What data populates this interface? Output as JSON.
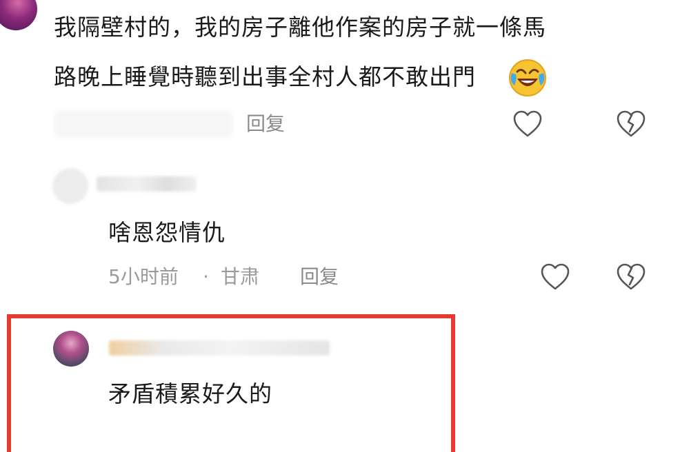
{
  "comments": [
    {
      "text_line1": "我隔壁村的，我的房子離他作案的房子就一條馬",
      "text_line2": "路晚上睡覺時聽到出事全村人都不敢出門",
      "reply_label": "回复",
      "emoji_name": "laughing-crying-face"
    },
    {
      "text": "啥恩怨情仇",
      "time": "5小时前",
      "separator": "·",
      "location": "甘肃",
      "reply_label": "回复"
    },
    {
      "text": "矛盾積累好久的"
    }
  ],
  "colors": {
    "highlight_border": "#e53a2d",
    "meta_text": "#9a9a9a",
    "icon_stroke": "#555555"
  },
  "icons": {
    "like": "heart-outline-icon",
    "dislike": "broken-heart-icon"
  }
}
